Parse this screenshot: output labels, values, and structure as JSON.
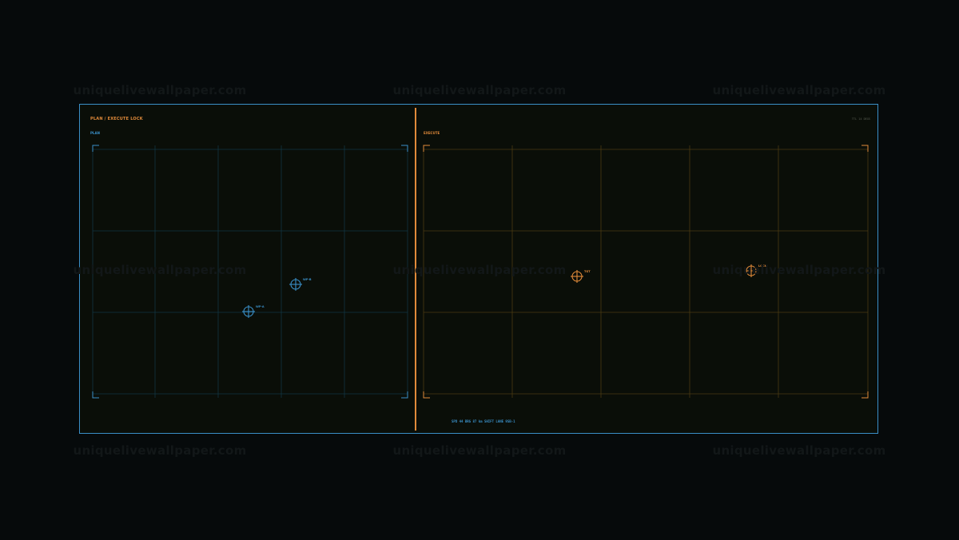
{
  "watermark": {
    "text": "uniquelivewallpaper.com"
  },
  "window": {
    "title": "PLAN / EXECUTE LOCK",
    "status_top": "TTL 14 DEGS",
    "status_bottom": "SPD 44  BRG 87 km  SHIFT  LANE 9SB-1"
  },
  "colors": {
    "frame": "#3a8fc7",
    "accent": "#e08a3a",
    "plan_grid": "#123543",
    "execute_grid": "#4a3a12",
    "background": "#060a0b",
    "panel": "#0a0e08"
  },
  "plan_panel": {
    "label": "PLAN",
    "markers": [
      {
        "id": "plan-marker-a",
        "label": "WP-A"
      },
      {
        "id": "plan-marker-b",
        "label": "WP-B"
      }
    ]
  },
  "execute_panel": {
    "label": "EXECUTE",
    "markers": [
      {
        "id": "execute-marker-a",
        "label": "TGT"
      },
      {
        "id": "execute-marker-b",
        "label": "LOCK"
      }
    ]
  }
}
